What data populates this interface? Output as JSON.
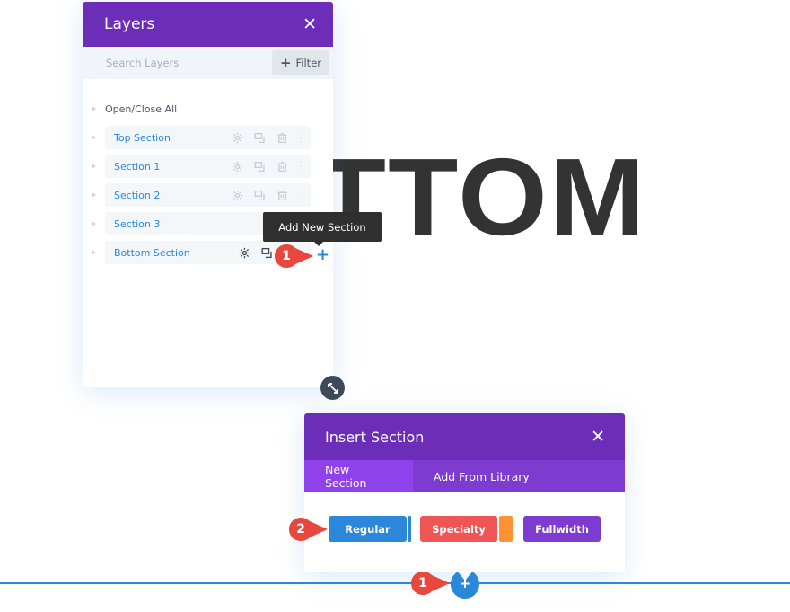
{
  "page": {
    "heading_text": "OTTOM"
  },
  "layers_panel": {
    "title": "Layers",
    "close_icon": "close-icon",
    "search_placeholder": "Search Layers",
    "filter_label": "Filter",
    "open_close_all": "Open/Close All",
    "items": [
      {
        "label": "Top Section",
        "active": false
      },
      {
        "label": "Section 1",
        "active": false
      },
      {
        "label": "Section 2",
        "active": false
      },
      {
        "label": "Section 3",
        "active": false
      },
      {
        "label": "Bottom Section",
        "active": true
      }
    ]
  },
  "tooltip": {
    "text": "Add New Section"
  },
  "markers": {
    "step_layers": "1",
    "step_regular": "2",
    "step_bottom": "1"
  },
  "insert_section_modal": {
    "title": "Insert Section",
    "tabs": [
      {
        "label": "New Section",
        "active": true
      },
      {
        "label": "Add From Library",
        "active": false
      }
    ],
    "buttons": {
      "regular": "Regular",
      "specialty": "Specialty",
      "fullwidth": "Fullwidth"
    }
  },
  "colors": {
    "header_purple": "#6c2eb9",
    "tab_purple": "#7e3bd0",
    "active_tab_purple": "#8f42ec",
    "accent_blue": "#2b87da",
    "specialty_red": "#ef5555",
    "specialty_orange": "#ff9232",
    "marker_red": "#e8473d"
  }
}
